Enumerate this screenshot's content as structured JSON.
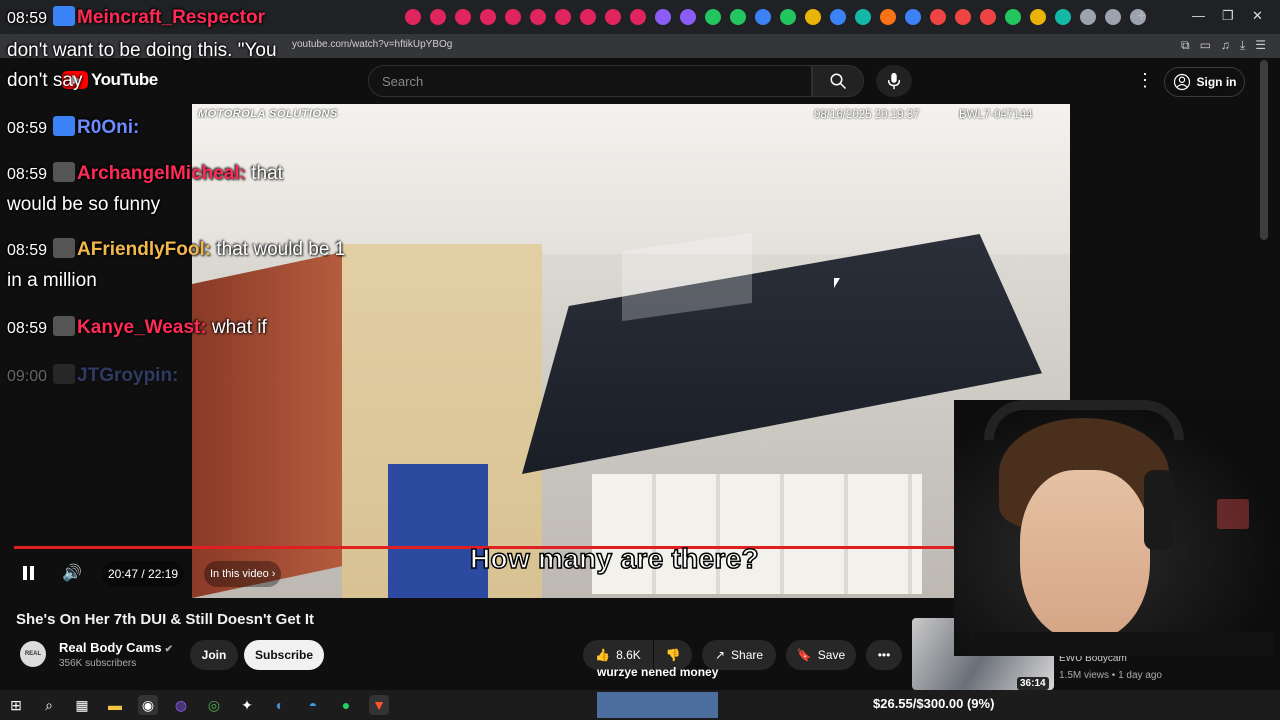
{
  "browser": {
    "url": "youtube.com/watch?v=hftikUpYBOg",
    "tab_colors": [
      "#e0245e",
      "#e0245e",
      "#e0245e",
      "#e0245e",
      "#e0245e",
      "#e0245e",
      "#e0245e",
      "#e0245e",
      "#e0245e",
      "#e0245e",
      "#8b5cf6",
      "#8b5cf6",
      "#22c55e",
      "#22c55e",
      "#3b82f6",
      "#22c55e",
      "#eab308",
      "#3b82f6",
      "#14b8a6",
      "#f97316",
      "#3b82f6",
      "#ef4444",
      "#ef4444",
      "#ef4444",
      "#22c55e",
      "#eab308",
      "#14b8a6",
      "#9ca3af",
      "#9ca3af",
      "#9ca3af"
    ]
  },
  "youtube": {
    "logo": "YouTube",
    "search_placeholder": "Search",
    "sign_in": "Sign in"
  },
  "video": {
    "cam_brand": "MOTOROLA SOLUTIONS",
    "cam_date": "08/16/2025 20:19:37",
    "cam_id": "BWL7-047144",
    "subtitle": "How many are there?",
    "time": "20:47 / 22:19",
    "chapter": "In this video",
    "progress": 0.932,
    "title": "She's On Her 7th DUI & Still Doesn't Get It"
  },
  "channel": {
    "name": "Real Body Cams",
    "subscribers": "356K subscribers",
    "avatar_text": "REAL",
    "join": "Join",
    "subscribe": "Subscribe"
  },
  "actions": {
    "likes": "8.6K",
    "share": "Share",
    "save": "Save"
  },
  "recommendation": {
    "duration": "36:14",
    "channel": "EWU Bodycam",
    "meta": "1.5M views • 1 day ago"
  },
  "chat": [
    {
      "time": "08:59",
      "user": "Meincraft_Respector",
      "color": "#ff2a55",
      "text": ""
    },
    {
      "time": "",
      "user": "",
      "color": "#ffffff",
      "text": "don't want to be doing this. \"You"
    },
    {
      "time": "",
      "user": "",
      "color": "#ffffff",
      "text": "don't say"
    },
    {
      "time": "08:59",
      "user": "R0Oni:",
      "color": "#6a8cff",
      "text": ""
    },
    {
      "time": "08:59",
      "user": "ArchangelMicheal:",
      "color": "#ff2a55",
      "text": "that"
    },
    {
      "time": "",
      "user": "",
      "color": "#ffffff",
      "text": "would be so funny"
    },
    {
      "time": "08:59",
      "user": "AFriendlyFool:",
      "color": "#f2b94a",
      "text": "that would be 1"
    },
    {
      "time": "",
      "user": "",
      "color": "#ffffff",
      "text": "in a million"
    },
    {
      "time": "08:59",
      "user": "Kanye_Weast:",
      "color": "#ff2a55",
      "text": "what if"
    },
    {
      "time": "09:00",
      "user": "JTGroypin:",
      "color": "#6a8cff",
      "text": ""
    }
  ],
  "stream": {
    "donation_text": "wurzye nened money",
    "goal": "$26.55/$300.00 (9%)",
    "goal_progress": 0.09
  }
}
